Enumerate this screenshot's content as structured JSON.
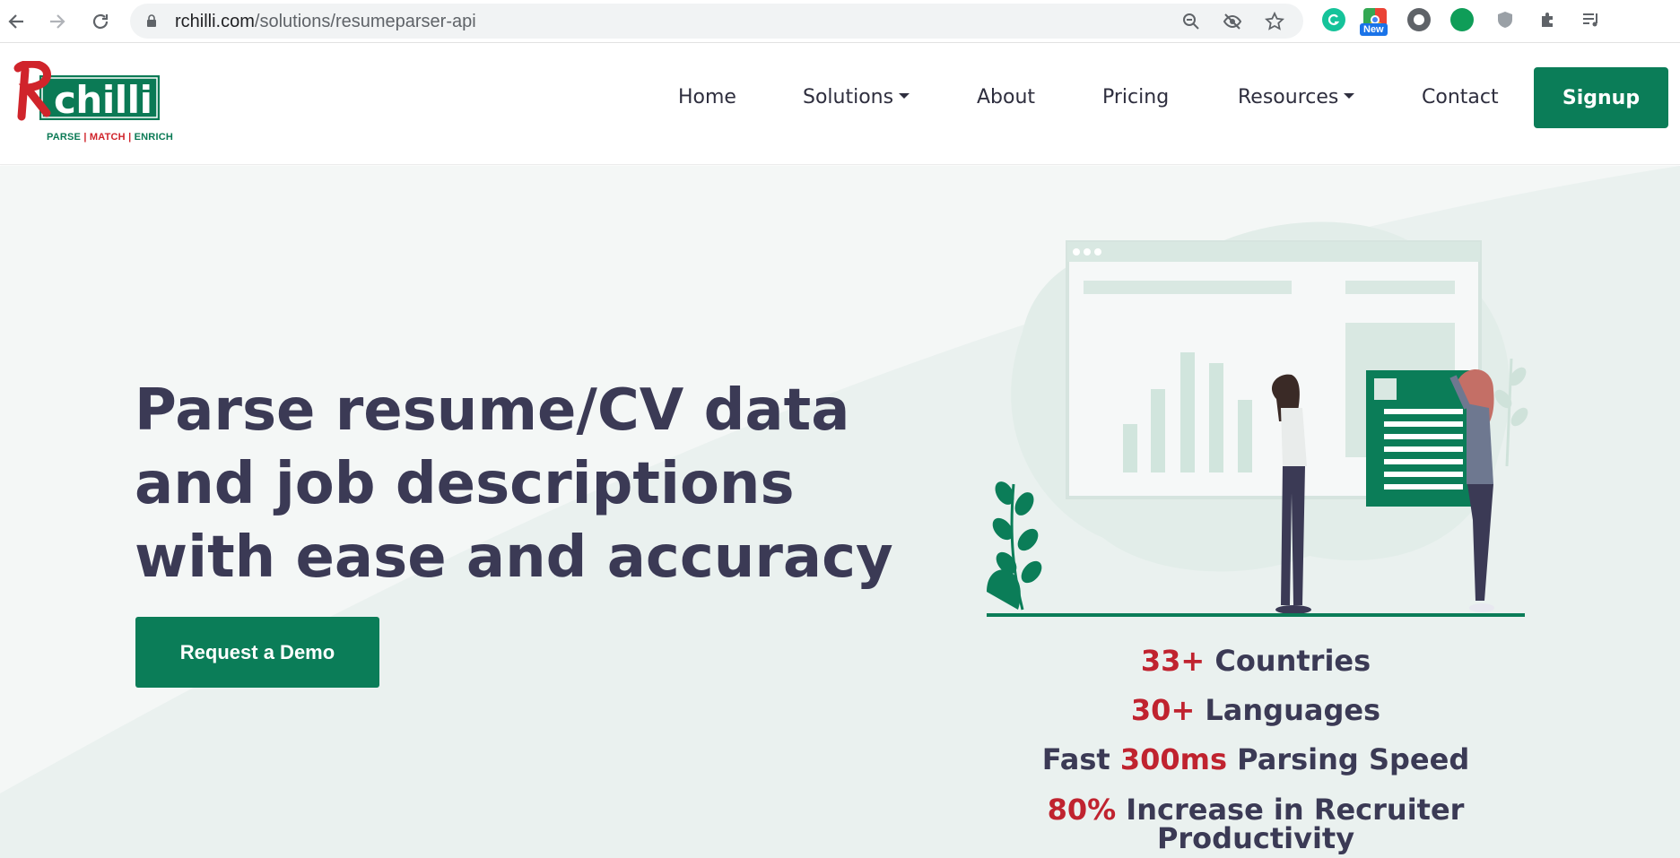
{
  "browser": {
    "url_host": "rchilli.com",
    "url_path": "/solutions/resumeparser-api",
    "new_badge": "New"
  },
  "header": {
    "logo": {
      "wordmark": "Rchilli",
      "tagline_parse": "PARSE",
      "tagline_match": "MATCH",
      "tagline_enrich": "ENRICH",
      "separator": "|"
    },
    "nav": [
      {
        "label": "Home"
      },
      {
        "label": "Solutions"
      },
      {
        "label": "About"
      },
      {
        "label": "Pricing"
      },
      {
        "label": "Resources"
      },
      {
        "label": "Contact"
      }
    ],
    "signup_label": "Signup"
  },
  "hero": {
    "headline_lines": [
      "Parse resume/CV data",
      "and job descriptions",
      "with ease and accuracy"
    ],
    "cta_label": "Request a Demo",
    "stats": [
      {
        "highlight": "33+",
        "text": " Countries"
      },
      {
        "highlight": "30+",
        "text": " Languages"
      },
      {
        "prefix": "Fast ",
        "highlight": "300ms",
        "text": " Parsing Speed"
      },
      {
        "highlight": "80%",
        "text": " Increase in Recruiter",
        "line2": "Productivity"
      }
    ]
  },
  "colors": {
    "brand_green": "#0b7d58",
    "accent_red": "#c0232f",
    "heading": "#3b3a55"
  }
}
